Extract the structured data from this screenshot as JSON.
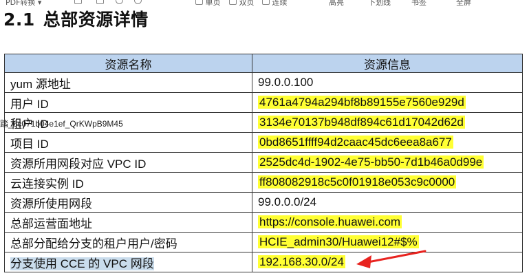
{
  "toolbar": {
    "pdf_convert": "PDF转换",
    "single_page": "单页",
    "double_page": "双页",
    "continuous": "连续",
    "highlight": "高亮",
    "underline": "下划线",
    "bookmark": "书签",
    "fullscreen": "全屏"
  },
  "section": {
    "number": "2.1",
    "title": "总部资源详情"
  },
  "table": {
    "headers": [
      "资源名称",
      "资源信息"
    ],
    "rows": [
      {
        "name": "yum 源地址",
        "value": "99.0.0.100",
        "highlighted": false
      },
      {
        "name": "用户 ID",
        "value": "4761a4794a294bf8b89155e7560e929d",
        "highlighted": true
      },
      {
        "name": "租户 ID",
        "value": "3134e70137b948df894c61d17042d62d",
        "highlighted": true
      },
      {
        "name": "项目 ID",
        "value": "0bd8651ffff94d2caac45dc6eea8a677",
        "highlighted": true
      },
      {
        "name": "资源所用网段对应 VPC ID",
        "value": "2525dc4d-1902-4e75-bb50-7d1b46a0d99e",
        "highlighted": true
      },
      {
        "name": "云连接实例 ID",
        "value": "ff808082918c5c0f01918e053c9c0000",
        "highlighted": true
      },
      {
        "name": "资源所使用网段",
        "value": "99.0.0.0/24",
        "highlighted": false
      },
      {
        "name": "总部运营面地址",
        "value": "https://console.huawei.com",
        "highlighted": true
      },
      {
        "name": "总部分配给分支的租户用户/密码",
        "value": "HCIE_admin30/Huawei12#$%",
        "highlighted": true
      },
      {
        "name": "分支使用 CCE 的 VPC 网段",
        "value": "192.168.30.0/24",
        "highlighted": true
      }
    ]
  },
  "overlay_text": "踏_6c071b04e1ef_QrKWpB9M45",
  "colors": {
    "header_bg": "#bcd3ee",
    "highlight": "#ffff33",
    "selection": "#c9dcec",
    "arrow": "#e8231f"
  }
}
